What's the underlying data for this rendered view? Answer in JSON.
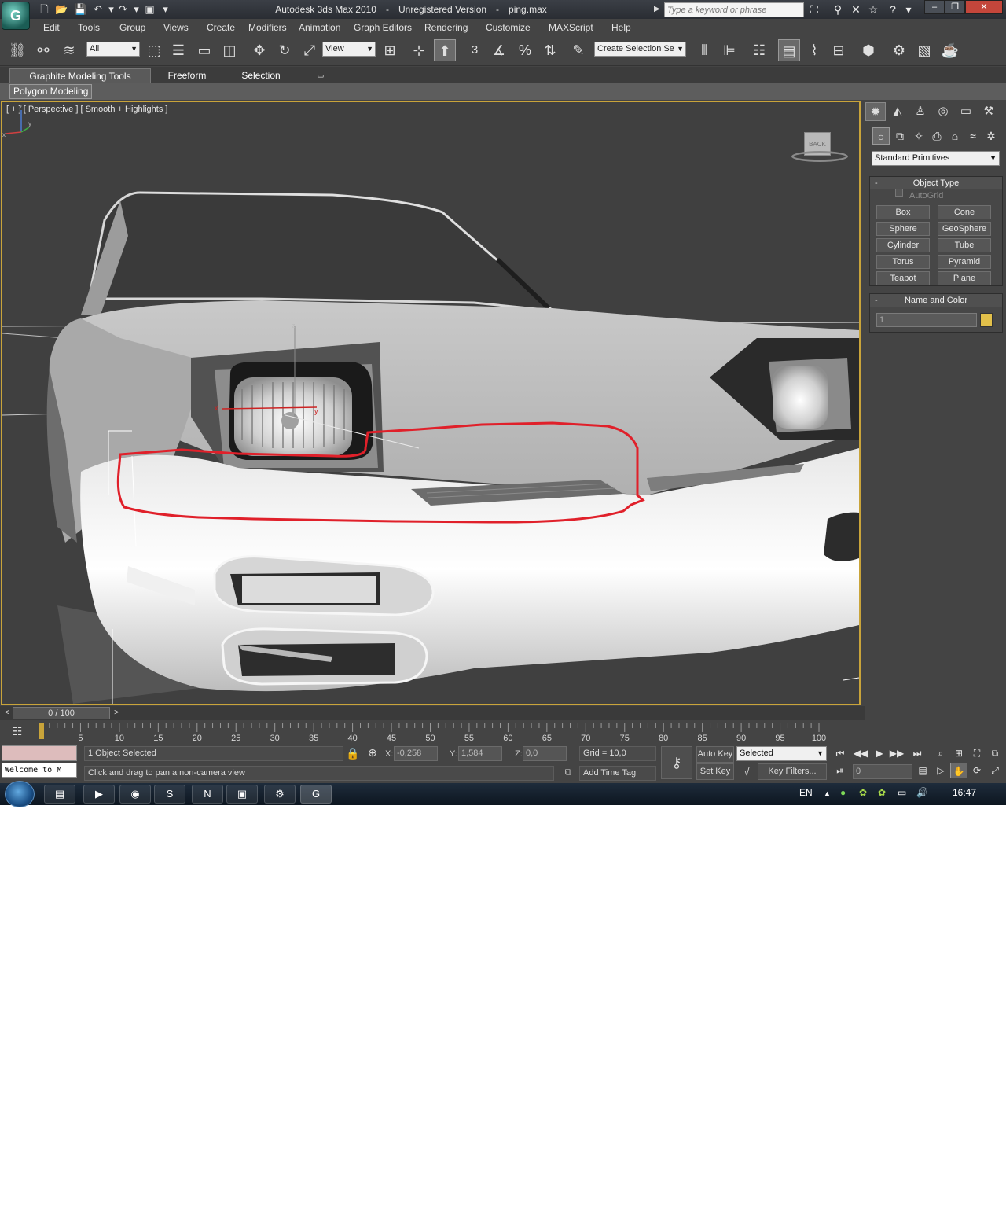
{
  "titlebar": {
    "app_name": "Autodesk 3ds Max  2010",
    "license": "Unregistered Version",
    "file": "ping.max",
    "search_placeholder": "Type a keyword or phrase"
  },
  "menu": [
    "Edit",
    "Tools",
    "Group",
    "Views",
    "Create",
    "Modifiers",
    "Animation",
    "Graph Editors",
    "Rendering",
    "Customize",
    "MAXScript",
    "Help"
  ],
  "toolbar": {
    "selection_filter": "All",
    "ref_coord": "View",
    "named_selection": "Create Selection Se",
    "snap_label": "3"
  },
  "ribbon": {
    "tabs": [
      "Graphite Modeling Tools",
      "Freeform",
      "Selection"
    ],
    "panel_button": "Polygon Modeling"
  },
  "viewport": {
    "label": "[ + ] [ Perspective ] [ Smooth + Highlights ]",
    "viewcube_face": "BACK",
    "gizmo_axes": {
      "x": "x",
      "y": "y",
      "z": "z"
    },
    "highlight_color": "#e0202a",
    "border_color": "#c9a43a"
  },
  "command_panel": {
    "primitive_type": "Standard Primitives",
    "object_type_title": "Object Type",
    "autogrid": "AutoGrid",
    "buttons": [
      "Box",
      "Cone",
      "Sphere",
      "GeoSphere",
      "Cylinder",
      "Tube",
      "Torus",
      "Pyramid",
      "Teapot",
      "Plane"
    ],
    "name_color_title": "Name and Color",
    "name_value": "1",
    "object_color": "#e2c04a"
  },
  "timeline": {
    "frame_display": "0 / 100",
    "ticks": [
      "5",
      "10",
      "15",
      "20",
      "25",
      "30",
      "35",
      "40",
      "45",
      "50",
      "55",
      "60",
      "65",
      "70",
      "75",
      "80",
      "85",
      "90",
      "95",
      "100"
    ]
  },
  "status": {
    "maxscript_text": "Welcome to M",
    "selection_info": "1 Object Selected",
    "prompt": "Click and drag to pan a non-camera view",
    "x_label": "X:",
    "x_value": "-0,258",
    "y_label": "Y:",
    "y_value": "1,584",
    "z_label": "Z:",
    "z_value": "0,0",
    "grid": "Grid = 10,0",
    "add_time_tag": "Add Time Tag",
    "auto_key": "Auto Key",
    "set_key": "Set Key",
    "key_mode": "Selected",
    "key_filters": "Key Filters...",
    "frame_value": "0"
  },
  "taskbar": {
    "language": "EN",
    "clock": "16:47"
  }
}
